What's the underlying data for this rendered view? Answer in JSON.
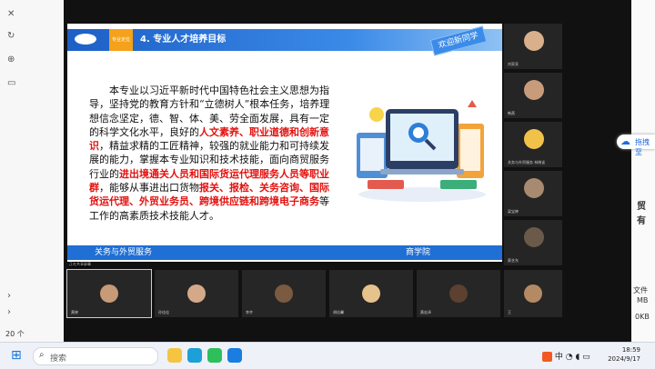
{
  "desktop": {
    "right_texts": [
      "贸",
      "有",
      "文件",
      "MB",
      "0KB"
    ],
    "bottom_left": "20 个"
  },
  "slide": {
    "badge": "专业定位",
    "title": "4. 专业人才培养目标",
    "welcome": "欢迎新同学",
    "body": [
      {
        "t": "本专业以习近平新时代中国特色社会主义思想为指导，坚持党的教育方针和“立德树人”根本任务，培养理想信念坚定，德、智、体、美、劳全面发展，具有一定的科学文化水平，良好的",
        "red": false
      },
      {
        "t": "人文素养、职业道德和创新意识",
        "red": true
      },
      {
        "t": "，精益求精的工匠精神，较强的就业能力和可持续发展的能力，掌握本专业知识和技术技能，面向商贸服务行业的",
        "red": false
      },
      {
        "t": "进出境通关人员和国际货运代理服务人员等职业群",
        "red": true
      },
      {
        "t": "，能够从事进出口货物",
        "red": false
      },
      {
        "t": "报关、报检、关务咨询、国际货运代理、外贸业务员、跨境供应链和跨境电子商务",
        "red": true
      },
      {
        "t": "等工作的高素质技术技能人才。",
        "red": false
      }
    ],
    "footer_left": "关务与外贸服务",
    "footer_right": "商学院"
  },
  "meeting": {
    "speaker_tag": "正在共享屏幕",
    "sidebar": [
      {
        "name": "刘家亮",
        "color": "#d9b08c"
      },
      {
        "name": "韩燕",
        "color": "#c89c7a"
      },
      {
        "name": "关务与外贸服务 林晓谈",
        "color": "#f1c24a"
      },
      {
        "name": "梁宝婷",
        "color": "#a88a70"
      },
      {
        "name": "蔡艺东",
        "color": "#6b5a4a"
      }
    ],
    "bottom": [
      {
        "name": "黄婷",
        "color": "#c79a78"
      },
      {
        "name": "孙佳佳",
        "color": "#d4a98a"
      },
      {
        "name": "李齐",
        "color": "#7a5a40"
      },
      {
        "name": "胡佳馨",
        "color": "#e6c28c"
      },
      {
        "name": "黄宏泽",
        "color": "#5c4030"
      },
      {
        "name": "王",
        "color": "#b48a64"
      }
    ]
  },
  "float_button": "拖拽至",
  "taskbar": {
    "search_placeholder": "搜索",
    "ime": "中",
    "time": "18:59",
    "date": "2024/9/17",
    "apps": [
      {
        "name": "app-edge",
        "color": "#1d9fd8"
      },
      {
        "name": "app-wechat",
        "color": "#2dbf5b"
      },
      {
        "name": "app-folder",
        "color": "#f5c542"
      },
      {
        "name": "app-ai",
        "color": "#1a7de0"
      }
    ]
  }
}
